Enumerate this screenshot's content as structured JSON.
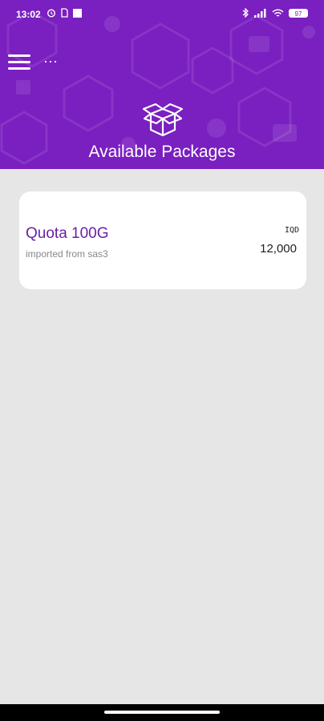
{
  "status_bar": {
    "time": "13:02",
    "battery": "97"
  },
  "header": {
    "title": "Available Packages",
    "more_label": "⋯"
  },
  "packages": [
    {
      "name": "Quota 100G",
      "source": "imported from sas3",
      "currency": "IQD",
      "price": "12,000"
    }
  ],
  "colors": {
    "header_bg": "#7a1fc0",
    "package_name": "#6a1fa8",
    "page_bg": "#e6e6e6"
  },
  "icons": [
    "alarm-icon",
    "sim-icon",
    "bluetooth-icon",
    "signal-icon",
    "wifi-icon",
    "battery-icon",
    "menu-icon",
    "box-icon"
  ]
}
